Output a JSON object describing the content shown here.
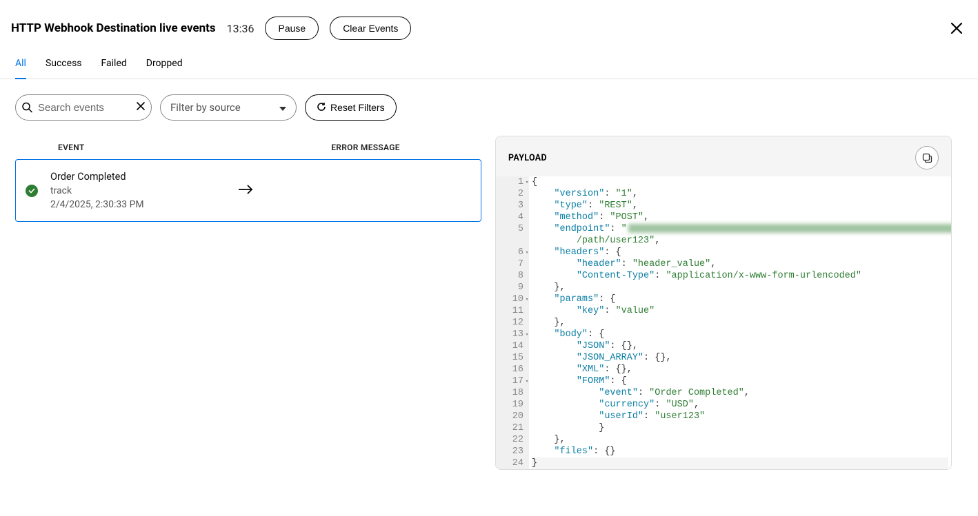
{
  "header": {
    "title": "HTTP Webhook Destination live events",
    "time": "13:36",
    "pause_label": "Pause",
    "clear_label": "Clear Events"
  },
  "tabs": {
    "all": "All",
    "success": "Success",
    "failed": "Failed",
    "dropped": "Dropped"
  },
  "filters": {
    "search_placeholder": "Search events",
    "source_placeholder": "Filter by source",
    "reset_label": "Reset Filters"
  },
  "table": {
    "col_event": "EVENT",
    "col_error": "ERROR MESSAGE"
  },
  "events": [
    {
      "name": "Order Completed",
      "type": "track",
      "timestamp": "2/4/2025, 2:30:33 PM",
      "status": "success"
    }
  ],
  "payload": {
    "header": "PAYLOAD",
    "data": {
      "version": "1",
      "type": "REST",
      "method": "POST",
      "endpoint": "/path/user123",
      "headers": {
        "header": "header_value",
        "Content-Type": "application/x-www-form-urlencoded"
      },
      "params": {
        "key": "value"
      },
      "body": {
        "JSON": {},
        "JSON_ARRAY": {},
        "XML": {},
        "FORM": {
          "event": "Order Completed",
          "currency": "USD",
          "userId": "user123"
        }
      },
      "files": {}
    },
    "line_numbers": [
      1,
      2,
      3,
      4,
      5,
      6,
      7,
      8,
      9,
      10,
      11,
      12,
      13,
      14,
      15,
      16,
      17,
      18,
      19,
      20,
      21,
      22,
      23,
      24
    ],
    "fold_lines": [
      1,
      6,
      10,
      13,
      17
    ]
  }
}
